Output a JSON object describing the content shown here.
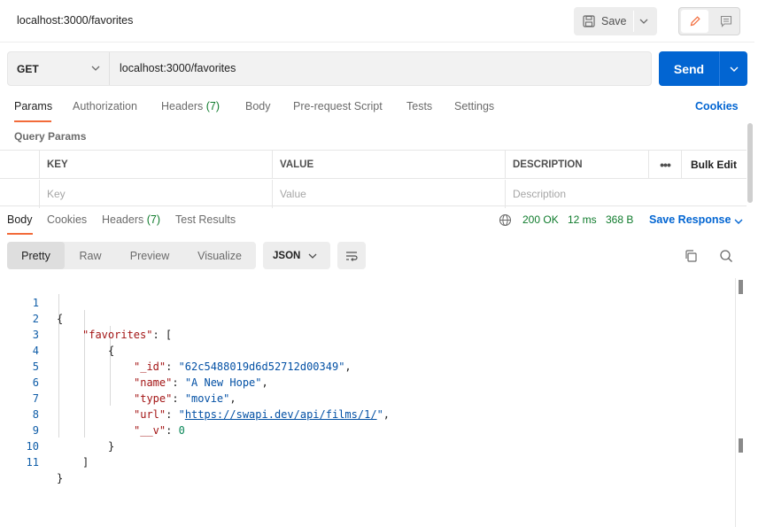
{
  "header": {
    "tab_title": "localhost:3000/favorites",
    "save_label": "Save"
  },
  "request": {
    "method": "GET",
    "url": "localhost:3000/favorites",
    "send_label": "Send"
  },
  "request_tabs": {
    "params": "Params",
    "authorization": "Authorization",
    "headers": "Headers",
    "headers_count": "(7)",
    "body": "Body",
    "pre_request": "Pre-request Script",
    "tests": "Tests",
    "settings": "Settings",
    "cookies": "Cookies"
  },
  "query_params": {
    "title": "Query Params",
    "col_key": "KEY",
    "col_value": "VALUE",
    "col_description": "DESCRIPTION",
    "bulk_edit": "Bulk Edit",
    "ph_key": "Key",
    "ph_value": "Value",
    "ph_description": "Description"
  },
  "response_tabs": {
    "body": "Body",
    "cookies": "Cookies",
    "headers": "Headers",
    "headers_count": "(7)",
    "test_results": "Test Results",
    "status": "200 OK",
    "time": "12 ms",
    "size": "368 B",
    "save_response": "Save Response"
  },
  "view": {
    "pretty": "Pretty",
    "raw": "Raw",
    "preview": "Preview",
    "visualize": "Visualize",
    "format": "JSON"
  },
  "code": {
    "line_numbers": [
      "1",
      "2",
      "3",
      "4",
      "5",
      "6",
      "7",
      "8",
      "9",
      "10",
      "11"
    ],
    "brace_open": "{",
    "favorites_key": "\"favorites\"",
    "bracket_open": ": [",
    "obj_open": "{",
    "id_key": "\"_id\"",
    "id_val": "\"62c5488019d6d52712d00349\"",
    "name_key": "\"name\"",
    "name_val": "\"A New Hope\"",
    "type_key": "\"type\"",
    "type_val": "\"movie\"",
    "url_key": "\"url\"",
    "url_val": "https://swapi.dev/api/films/1/",
    "v_key": "\"__v\"",
    "v_val": "0",
    "obj_close": "}",
    "bracket_close": "]",
    "brace_close": "}"
  },
  "colors": {
    "accent": "#0265d2",
    "tab_underline": "#f26b3a",
    "status_green": "#0f7b2c",
    "json_key": "#a31515",
    "json_string": "#0451a5",
    "json_number": "#098658"
  }
}
